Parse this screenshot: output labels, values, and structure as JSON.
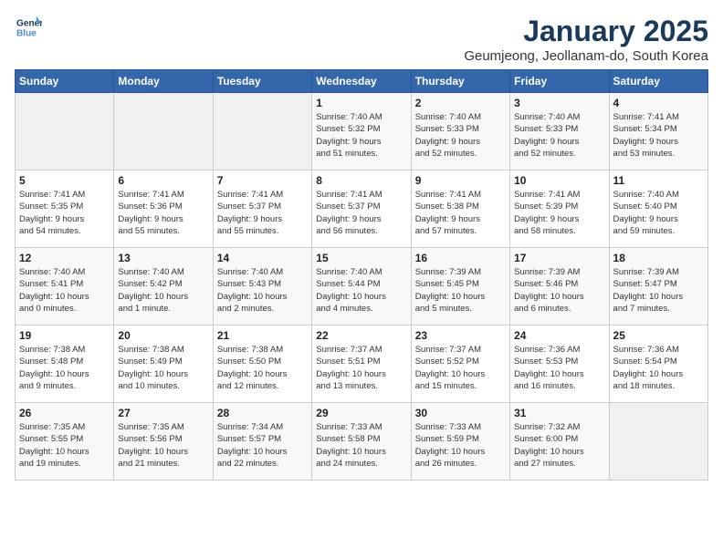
{
  "app": {
    "logo_line1": "General",
    "logo_line2": "Blue"
  },
  "header": {
    "title": "January 2025",
    "subtitle": "Geumjeong, Jeollanam-do, South Korea"
  },
  "weekdays": [
    "Sunday",
    "Monday",
    "Tuesday",
    "Wednesday",
    "Thursday",
    "Friday",
    "Saturday"
  ],
  "weeks": [
    [
      {
        "day": "",
        "info": ""
      },
      {
        "day": "",
        "info": ""
      },
      {
        "day": "",
        "info": ""
      },
      {
        "day": "1",
        "info": "Sunrise: 7:40 AM\nSunset: 5:32 PM\nDaylight: 9 hours\nand 51 minutes."
      },
      {
        "day": "2",
        "info": "Sunrise: 7:40 AM\nSunset: 5:33 PM\nDaylight: 9 hours\nand 52 minutes."
      },
      {
        "day": "3",
        "info": "Sunrise: 7:40 AM\nSunset: 5:33 PM\nDaylight: 9 hours\nand 52 minutes."
      },
      {
        "day": "4",
        "info": "Sunrise: 7:41 AM\nSunset: 5:34 PM\nDaylight: 9 hours\nand 53 minutes."
      }
    ],
    [
      {
        "day": "5",
        "info": "Sunrise: 7:41 AM\nSunset: 5:35 PM\nDaylight: 9 hours\nand 54 minutes."
      },
      {
        "day": "6",
        "info": "Sunrise: 7:41 AM\nSunset: 5:36 PM\nDaylight: 9 hours\nand 55 minutes."
      },
      {
        "day": "7",
        "info": "Sunrise: 7:41 AM\nSunset: 5:37 PM\nDaylight: 9 hours\nand 55 minutes."
      },
      {
        "day": "8",
        "info": "Sunrise: 7:41 AM\nSunset: 5:37 PM\nDaylight: 9 hours\nand 56 minutes."
      },
      {
        "day": "9",
        "info": "Sunrise: 7:41 AM\nSunset: 5:38 PM\nDaylight: 9 hours\nand 57 minutes."
      },
      {
        "day": "10",
        "info": "Sunrise: 7:41 AM\nSunset: 5:39 PM\nDaylight: 9 hours\nand 58 minutes."
      },
      {
        "day": "11",
        "info": "Sunrise: 7:40 AM\nSunset: 5:40 PM\nDaylight: 9 hours\nand 59 minutes."
      }
    ],
    [
      {
        "day": "12",
        "info": "Sunrise: 7:40 AM\nSunset: 5:41 PM\nDaylight: 10 hours\nand 0 minutes."
      },
      {
        "day": "13",
        "info": "Sunrise: 7:40 AM\nSunset: 5:42 PM\nDaylight: 10 hours\nand 1 minute."
      },
      {
        "day": "14",
        "info": "Sunrise: 7:40 AM\nSunset: 5:43 PM\nDaylight: 10 hours\nand 2 minutes."
      },
      {
        "day": "15",
        "info": "Sunrise: 7:40 AM\nSunset: 5:44 PM\nDaylight: 10 hours\nand 4 minutes."
      },
      {
        "day": "16",
        "info": "Sunrise: 7:39 AM\nSunset: 5:45 PM\nDaylight: 10 hours\nand 5 minutes."
      },
      {
        "day": "17",
        "info": "Sunrise: 7:39 AM\nSunset: 5:46 PM\nDaylight: 10 hours\nand 6 minutes."
      },
      {
        "day": "18",
        "info": "Sunrise: 7:39 AM\nSunset: 5:47 PM\nDaylight: 10 hours\nand 7 minutes."
      }
    ],
    [
      {
        "day": "19",
        "info": "Sunrise: 7:38 AM\nSunset: 5:48 PM\nDaylight: 10 hours\nand 9 minutes."
      },
      {
        "day": "20",
        "info": "Sunrise: 7:38 AM\nSunset: 5:49 PM\nDaylight: 10 hours\nand 10 minutes."
      },
      {
        "day": "21",
        "info": "Sunrise: 7:38 AM\nSunset: 5:50 PM\nDaylight: 10 hours\nand 12 minutes."
      },
      {
        "day": "22",
        "info": "Sunrise: 7:37 AM\nSunset: 5:51 PM\nDaylight: 10 hours\nand 13 minutes."
      },
      {
        "day": "23",
        "info": "Sunrise: 7:37 AM\nSunset: 5:52 PM\nDaylight: 10 hours\nand 15 minutes."
      },
      {
        "day": "24",
        "info": "Sunrise: 7:36 AM\nSunset: 5:53 PM\nDaylight: 10 hours\nand 16 minutes."
      },
      {
        "day": "25",
        "info": "Sunrise: 7:36 AM\nSunset: 5:54 PM\nDaylight: 10 hours\nand 18 minutes."
      }
    ],
    [
      {
        "day": "26",
        "info": "Sunrise: 7:35 AM\nSunset: 5:55 PM\nDaylight: 10 hours\nand 19 minutes."
      },
      {
        "day": "27",
        "info": "Sunrise: 7:35 AM\nSunset: 5:56 PM\nDaylight: 10 hours\nand 21 minutes."
      },
      {
        "day": "28",
        "info": "Sunrise: 7:34 AM\nSunset: 5:57 PM\nDaylight: 10 hours\nand 22 minutes."
      },
      {
        "day": "29",
        "info": "Sunrise: 7:33 AM\nSunset: 5:58 PM\nDaylight: 10 hours\nand 24 minutes."
      },
      {
        "day": "30",
        "info": "Sunrise: 7:33 AM\nSunset: 5:59 PM\nDaylight: 10 hours\nand 26 minutes."
      },
      {
        "day": "31",
        "info": "Sunrise: 7:32 AM\nSunset: 6:00 PM\nDaylight: 10 hours\nand 27 minutes."
      },
      {
        "day": "",
        "info": ""
      }
    ]
  ]
}
